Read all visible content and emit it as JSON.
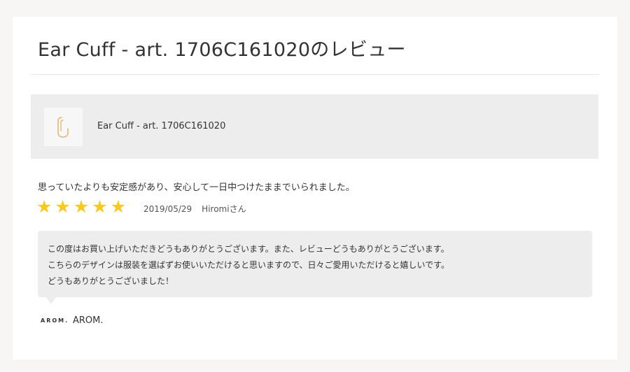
{
  "page": {
    "title": "Ear Cuff - art. 1706C161020のレビュー"
  },
  "product": {
    "name": "Ear Cuff - art. 1706C161020",
    "thumbnail_icon": "ear-cuff-image"
  },
  "review": {
    "text": "思っていたよりも安定感があり、安心して一日中つけたままでいられました。",
    "rating": 5,
    "rating_max": 5,
    "star_glyph": "★",
    "star_color": "#f5cb1c",
    "date": "2019/05/29",
    "author": "Hiromiさん"
  },
  "reply": {
    "lines": [
      "この度はお買い上げいただきどうもありがとうございます。また、レビューどうもありがとうございます。",
      "こちらのデザインは服装を選ばずお使いいただけると思いますので、日々ご愛用いただけると嬉しいです。",
      "どうもありがとうございました！"
    ],
    "shop_logo": "AROM.",
    "shop_name": "AROM."
  }
}
